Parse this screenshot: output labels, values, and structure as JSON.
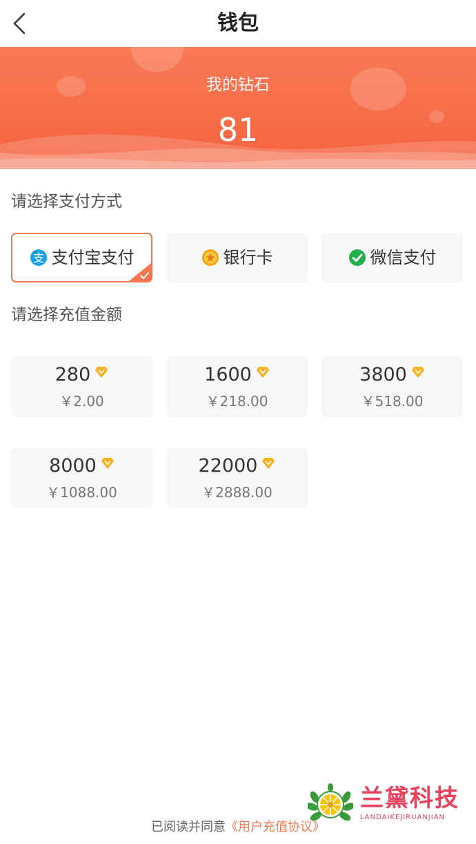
{
  "nav": {
    "title": "钱包"
  },
  "banner": {
    "label": "我的钻石",
    "value": "81"
  },
  "payment": {
    "heading": "请选择支付方式",
    "options": [
      {
        "label": "支付宝支付",
        "icon": "alipay-icon",
        "selected": true
      },
      {
        "label": "银行卡",
        "icon": "bank-card-icon",
        "selected": false
      },
      {
        "label": "微信支付",
        "icon": "wechat-icon",
        "selected": false
      }
    ]
  },
  "recharge": {
    "heading": "请选择充值金额",
    "options": [
      {
        "diamonds": "280",
        "price": "￥2.00"
      },
      {
        "diamonds": "1600",
        "price": "￥218.00"
      },
      {
        "diamonds": "3800",
        "price": "￥518.00"
      },
      {
        "diamonds": "8000",
        "price": "￥1088.00"
      },
      {
        "diamonds": "22000",
        "price": "￥2888.00"
      }
    ]
  },
  "footer": {
    "prefix": "已阅读并同意",
    "link": "《用户充值协议》"
  },
  "watermark": {
    "text": "兰黛科技",
    "sub": "LANDAIKEJIRUANJIAN"
  },
  "colors": {
    "accent": "#f4774f",
    "banner_top": "#f97a55",
    "banner_bottom": "#f4633f",
    "diamond": "#f7b21f"
  }
}
